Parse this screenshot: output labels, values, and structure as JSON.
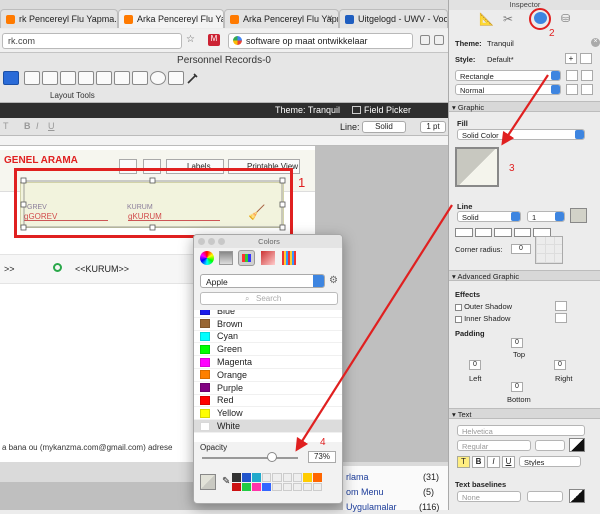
{
  "browser": {
    "tabs": [
      {
        "label": "rk Pencereyl Flu Yapma.. - Filemakerturk.com - Filemak..."
      },
      {
        "label": "Arka Pencereyl Flu Yapma.. - Filemakerturk.com - Fil..."
      },
      {
        "label": "Arka Pencereyl Flu Yapma.. - Filemakerturk.com - Filemak..."
      },
      {
        "label": "Uitgelogd - UWV - Voor Pa..."
      }
    ],
    "url": "rk.com",
    "search_text": "software op maat ontwikkelaar",
    "brand_colors": {
      "tab_favicon_orange": "#ff7a00",
      "tab_favicon_blue": "#1f5ec0"
    }
  },
  "filemaker": {
    "window_title": "Personnel Records-0",
    "layout_tools_label": "Layout Tools",
    "theme_label": "Theme: Tranquil",
    "field_picker_label": "Field Picker",
    "line_label": "Line:",
    "line_style": "Solid",
    "line_width": "1 pt",
    "format_buttons": [
      "B",
      "I",
      "U"
    ],
    "header_title": "GENEL ARAMA",
    "button_labels": [
      "Labels",
      "Printable View"
    ],
    "field_labels": [
      "GREV",
      "KURUM"
    ],
    "field_values": [
      "gGOREV",
      "gKURUM"
    ],
    "row_values": [
      ">>",
      "<<KURUM>>"
    ],
    "background_text": "a bana ou (mykanzma.com@gmail.com) adrese",
    "list_items": [
      {
        "label": "rlama",
        "count": "(31)"
      },
      {
        "label": "om Menu",
        "count": "(5)"
      },
      {
        "label": "Uygulamalar",
        "count": "(116)"
      }
    ]
  },
  "colors_panel": {
    "title": "Colors",
    "palette": "Apple",
    "search_placeholder": "Search",
    "colors": [
      {
        "name": "Blue",
        "hex": "#1b1bea"
      },
      {
        "name": "Brown",
        "hex": "#996633"
      },
      {
        "name": "Cyan",
        "hex": "#00ffff"
      },
      {
        "name": "Green",
        "hex": "#00ff00"
      },
      {
        "name": "Magenta",
        "hex": "#ff00ff"
      },
      {
        "name": "Orange",
        "hex": "#ff8000"
      },
      {
        "name": "Purple",
        "hex": "#800080"
      },
      {
        "name": "Red",
        "hex": "#ff0000"
      },
      {
        "name": "Yellow",
        "hex": "#ffff00"
      },
      {
        "name": "White",
        "hex": "#ffffff"
      }
    ],
    "selected": "White",
    "opacity_label": "Opacity",
    "opacity_value": "73%",
    "opacity_fraction": 0.73
  },
  "inspector": {
    "title": "Inspector",
    "theme_label": "Theme:",
    "theme_value": "Tranquil",
    "style_label": "Style:",
    "style_value": "Default*",
    "object_type": "Rectangle",
    "state": "Normal",
    "graphic_section": "Graphic",
    "fill_label": "Fill",
    "fill_type": "Solid Color",
    "line_label": "Line",
    "line_style": "Solid",
    "line_width": "1",
    "corner_radius_label": "Corner radius:",
    "corner_radius": "0",
    "advanced_section": "Advanced Graphic",
    "effects_label": "Effects",
    "outer_shadow": "Outer Shadow",
    "inner_shadow": "Inner Shadow",
    "padding_label": "Padding",
    "padding": {
      "top": "0",
      "left": "0",
      "right": "0",
      "bottom": "0"
    },
    "padding_sides": {
      "top": "Top",
      "left": "Left",
      "right": "Right",
      "bottom": "Bottom"
    },
    "text_section": "Text",
    "font": "Helvetica",
    "font_style": "Regular",
    "styles_label": "Styles",
    "text_format": [
      "T",
      "B",
      "I",
      "U"
    ],
    "text_baselines": "Text baselines",
    "baseline_value": "None"
  },
  "annotations": [
    "1",
    "2",
    "3",
    "4"
  ],
  "annotation_color": "#e02020"
}
